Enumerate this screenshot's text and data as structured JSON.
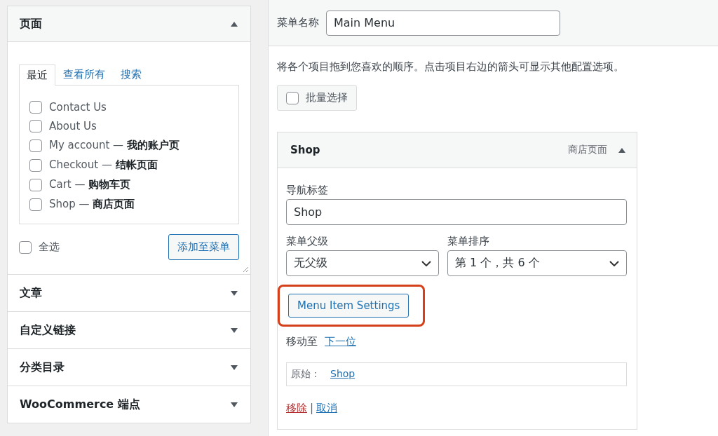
{
  "left_panel": {
    "pages_section": {
      "title": "页面",
      "expanded": true,
      "tabs": [
        {
          "label": "最近",
          "selected": true
        },
        {
          "label": "查看所有",
          "selected": false
        },
        {
          "label": "搜索",
          "selected": false
        }
      ],
      "items": [
        {
          "label": "Contact Us",
          "checked": false
        },
        {
          "label": "About Us",
          "checked": false
        },
        {
          "label": "My account — **我的账户页**",
          "checked": false
        },
        {
          "label": "Checkout — **结帐页面**",
          "checked": false
        },
        {
          "label": "Cart — **购物车页**",
          "checked": false
        },
        {
          "label": "Shop — **商店页面**",
          "checked": false
        }
      ],
      "select_all": {
        "label": "全选",
        "checked": false
      },
      "add_button": "添加至菜单"
    },
    "sections": [
      {
        "title": "文章",
        "expanded": false
      },
      {
        "title": "自定义链接",
        "expanded": false
      },
      {
        "title": "分类目录",
        "expanded": false
      },
      {
        "title": "WooCommerce 端点",
        "expanded": false
      }
    ]
  },
  "menu_editor": {
    "menu_name_label": "菜单名称",
    "menu_name": "Main Menu",
    "instructions": "将各个项目拖到您喜欢的顺序。点击项目右边的箭头可显示其他配置选项。",
    "bulk_select": {
      "label": "批量选择",
      "checked": false
    },
    "item": {
      "title": "Shop",
      "type": "商店页面",
      "expanded": true,
      "nav_label_label": "导航标签",
      "nav_label": "Shop",
      "parent_label": "菜单父级",
      "parent": "无父级",
      "order_label": "菜单排序",
      "order": "第 1 个，共 6 个",
      "settings_button": "Menu Item Settings",
      "settings_highlighted": true,
      "move_label": "移动至",
      "move_link": "下一位",
      "original_label": "原始：",
      "original_link": "Shop",
      "remove_link": "移除",
      "separator": "|",
      "cancel_link": "取消"
    }
  }
}
